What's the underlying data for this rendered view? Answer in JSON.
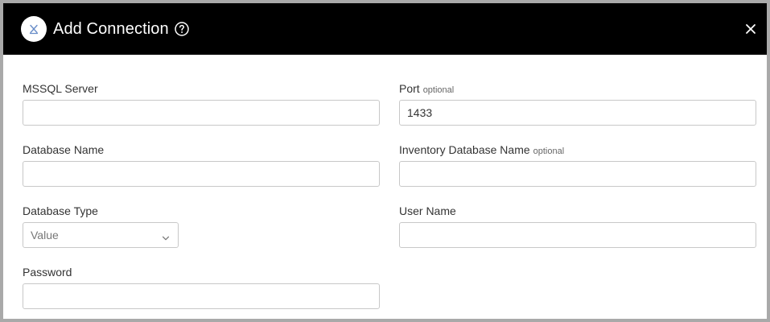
{
  "dialog": {
    "title": "Add Connection"
  },
  "form": {
    "optional_tag": "optional",
    "mssql_server": {
      "label": "MSSQL Server",
      "value": ""
    },
    "port": {
      "label": "Port",
      "value": "1433"
    },
    "database_name": {
      "label": "Database Name",
      "value": ""
    },
    "inventory_database_name": {
      "label": "Inventory Database Name",
      "value": ""
    },
    "database_type": {
      "label": "Database Type",
      "selected": "Value"
    },
    "user_name": {
      "label": "User Name",
      "value": ""
    },
    "password": {
      "label": "Password",
      "value": ""
    }
  },
  "icons": {
    "app_badge": "database-connection-icon",
    "help": "help-circle-icon",
    "close": "close-icon",
    "select": "chevron-down-icon"
  },
  "colors": {
    "header_background": "#000000",
    "header_text": "#ffffff",
    "input_border": "#c8c8c8",
    "frame_border": "#a9a9a9"
  }
}
